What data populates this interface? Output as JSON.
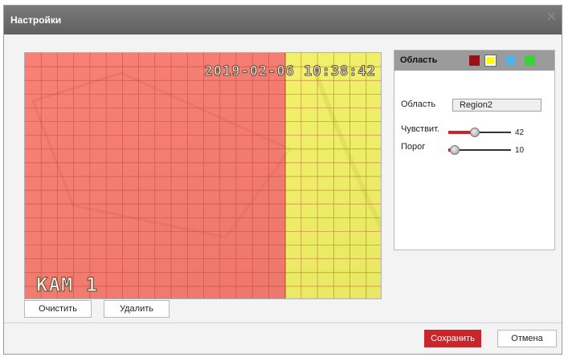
{
  "dialog": {
    "title": "Настройки",
    "close_glyph": "✕"
  },
  "video": {
    "timestamp": "2019-02-06 10:38:42",
    "camera_label": "KAM 1"
  },
  "buttons": {
    "clear": "Очистить",
    "delete": "Удалить",
    "save": "Сохранить",
    "cancel": "Отмена"
  },
  "panel": {
    "header": "Область",
    "swatches": [
      {
        "name": "region1",
        "color": "#9b0f16",
        "selected": false
      },
      {
        "name": "region2",
        "color": "#ffff00",
        "selected": true
      },
      {
        "name": "region3",
        "color": "#4fb3e8",
        "selected": false
      },
      {
        "name": "region4",
        "color": "#33d633",
        "selected": false
      }
    ],
    "region_label": "Область",
    "region_value": "Region2",
    "sensitivity_label": "Чувствит.",
    "sensitivity_value": 42,
    "threshold_label": "Порог",
    "threshold_value": 10
  },
  "colors": {
    "accent": "#c8262b",
    "region1_overlay": "#ff5a4a",
    "region2_overlay": "#ffff33"
  }
}
